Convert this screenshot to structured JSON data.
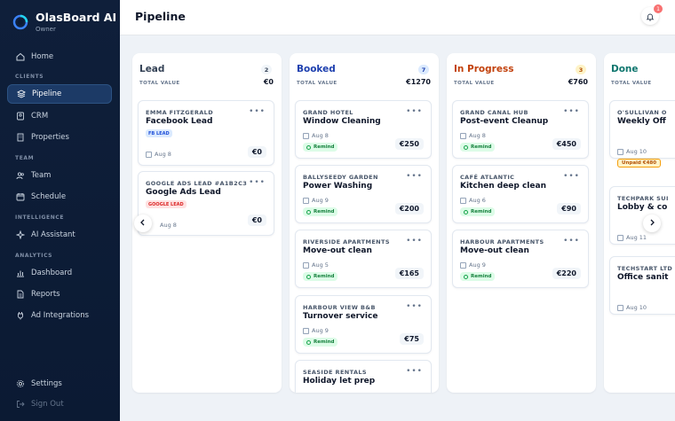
{
  "brand": {
    "name": "OlasBoard AI",
    "role": "Owner"
  },
  "nav": {
    "home": "Home",
    "section_clients": "CLIENTS",
    "pipeline": "Pipeline",
    "crm": "CRM",
    "properties": "Properties",
    "section_team": "TEAM",
    "team": "Team",
    "schedule": "Schedule",
    "section_intelligence": "INTELLIGENCE",
    "ai_assistant": "AI Assistant",
    "section_analytics": "ANALYTICS",
    "dashboard": "Dashboard",
    "reports": "Reports",
    "ad_integrations": "Ad Integrations",
    "settings": "Settings",
    "sign_out": "Sign Out"
  },
  "header": {
    "title": "Pipeline",
    "notification_count": "1"
  },
  "total_value_label": "TOTAL VALUE",
  "remind_label": "Remind",
  "colors": {
    "lead": "#334155",
    "booked": "#1e40af",
    "in_progress": "#c2410c",
    "done": "#0f766e",
    "accent": "#3b82f6"
  },
  "columns": [
    {
      "title": "Lead",
      "count": "2",
      "total": "€0",
      "cards": [
        {
          "client": "EMMA FITZGERALD",
          "title": "Facebook Lead",
          "tag": "FB LEAD",
          "date": "Aug 8",
          "amount": "€0"
        },
        {
          "client": "GOOGLE ADS LEAD #A1B2C3",
          "title": "Google Ads Lead",
          "tag": "GOOGLE LEAD",
          "date": "Aug 8",
          "amount": "€0"
        }
      ]
    },
    {
      "title": "Booked",
      "count": "7",
      "total": "€1270",
      "cards": [
        {
          "client": "GRAND HOTEL",
          "title": "Window Cleaning",
          "date": "Aug 8",
          "amount": "€250"
        },
        {
          "client": "BALLYSEEDY GARDEN",
          "title": "Power Washing",
          "date": "Aug 9",
          "amount": "€200"
        },
        {
          "client": "RIVERSIDE APARTMENTS",
          "title": "Move-out clean",
          "date": "Aug 5",
          "amount": "€165"
        },
        {
          "client": "HARBOUR VIEW B&B",
          "title": "Turnover service",
          "date": "Aug 9",
          "amount": "€75"
        },
        {
          "client": "SEASIDE RENTALS",
          "title": "Holiday let prep"
        }
      ]
    },
    {
      "title": "In Progress",
      "count": "3",
      "total": "€760",
      "cards": [
        {
          "client": "GRAND CANAL HUB",
          "title": "Post-event Cleanup",
          "date": "Aug 8",
          "amount": "€450"
        },
        {
          "client": "CAFÉ ATLANTIC",
          "title": "Kitchen deep clean",
          "date": "Aug 6",
          "amount": "€90"
        },
        {
          "client": "HARBOUR APARTMENTS",
          "title": "Move-out clean",
          "date": "Aug 9",
          "amount": "€220"
        }
      ]
    },
    {
      "title": "Done",
      "cards": [
        {
          "client": "O'SULLIVAN O",
          "title": "Weekly Off",
          "date": "Aug 10",
          "badge": "Unpaid €480"
        },
        {
          "client": "TECHPARK SUI",
          "title": "Lobby & co",
          "date": "Aug 11"
        },
        {
          "client": "TECHSTART LTD",
          "title": "Office sanit",
          "date": "Aug 10"
        }
      ]
    }
  ]
}
